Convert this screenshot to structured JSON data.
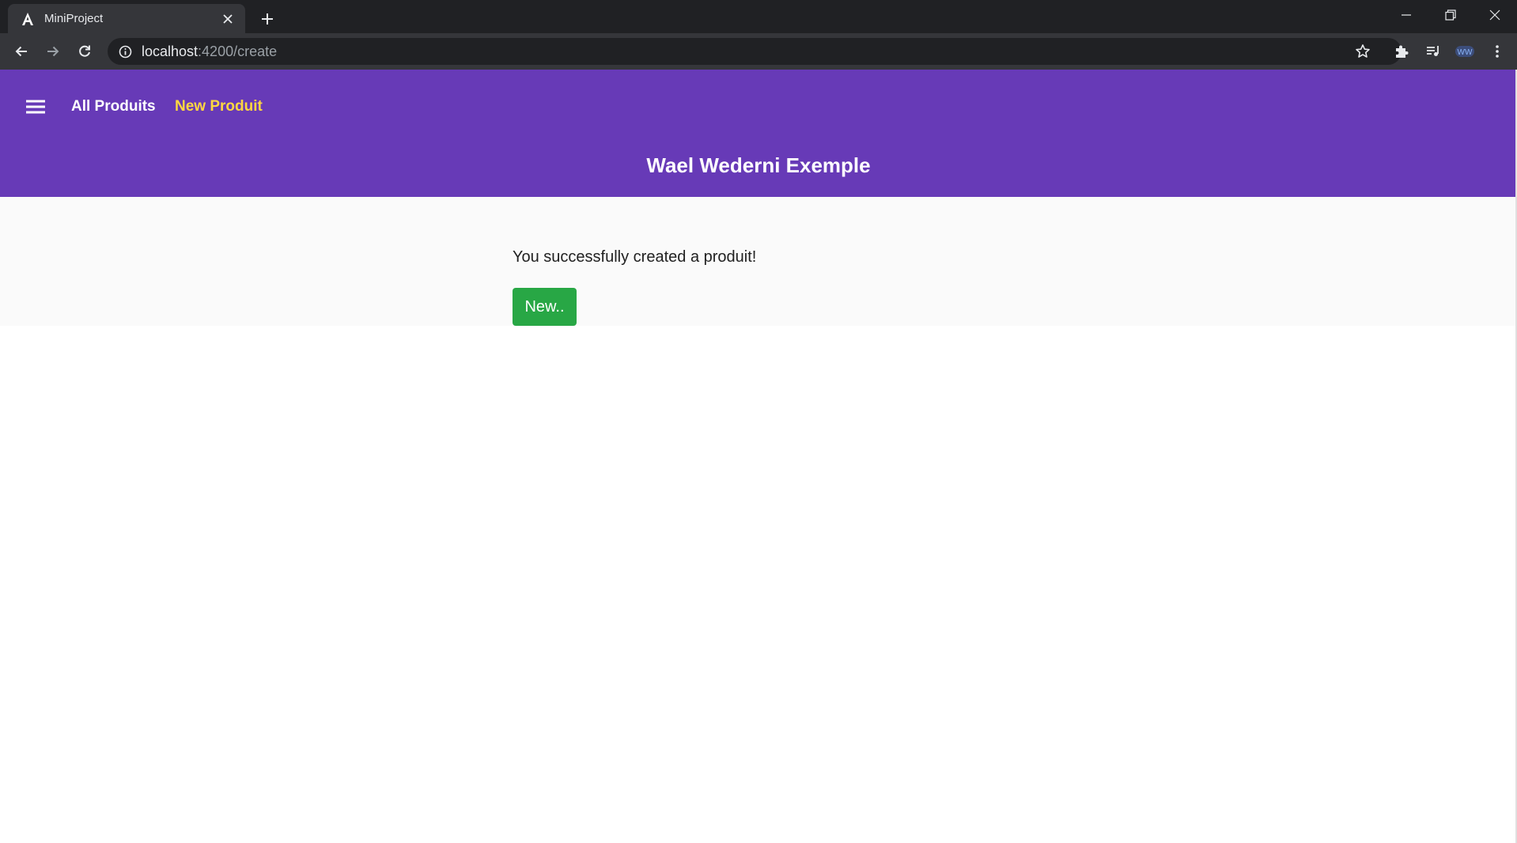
{
  "browser": {
    "tab": {
      "title": "MiniProject",
      "favicon": "angular-icon"
    },
    "address_bar": {
      "host": "localhost",
      "path": ":4200/create"
    }
  },
  "app": {
    "header": {
      "nav": [
        {
          "label": "All Produits",
          "active": false
        },
        {
          "label": "New Produit",
          "active": true
        }
      ],
      "title": "Wael Wederni Exemple"
    },
    "content": {
      "message": "You successfully created a produit!",
      "new_button_label": "New.."
    }
  },
  "colors": {
    "header_bg": "#673ab7",
    "active_link": "#ffd740",
    "button_bg": "#28a745",
    "content_bg": "#fafafa"
  }
}
